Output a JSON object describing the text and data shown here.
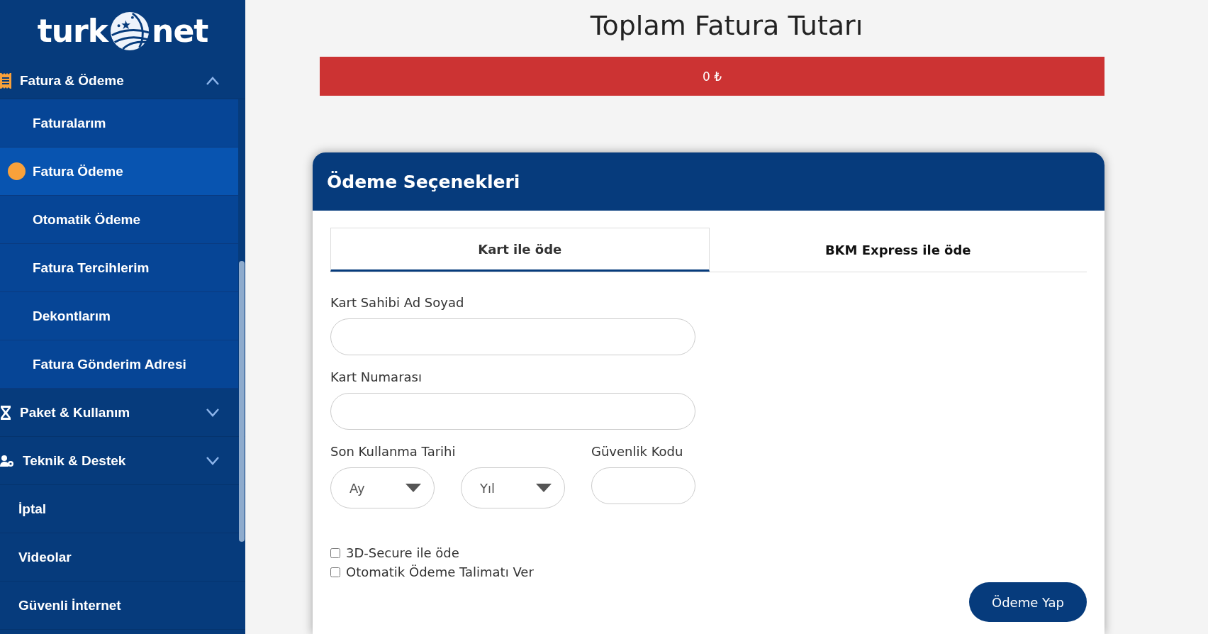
{
  "sidebar": {
    "logo": {
      "left": "turk",
      "right": "net"
    },
    "items": [
      {
        "kind": "group",
        "label": "Fatura & Ödeme",
        "expanded": true,
        "children": [
          {
            "label": "Faturalarım",
            "selected": false
          },
          {
            "label": "Fatura Ödeme",
            "selected": true
          },
          {
            "label": "Otomatik Ödeme",
            "selected": false
          },
          {
            "label": "Fatura Tercihlerim",
            "selected": false
          },
          {
            "label": "Dekontlarım",
            "selected": false
          },
          {
            "label": "Fatura Gönderim Adresi",
            "selected": false
          }
        ]
      },
      {
        "kind": "group",
        "label": "Paket & Kullanım",
        "expanded": false
      },
      {
        "kind": "group",
        "label": "Teknik & Destek",
        "expanded": false
      },
      {
        "kind": "link",
        "label": "İptal"
      },
      {
        "kind": "link",
        "label": "Videolar"
      },
      {
        "kind": "link",
        "label": "Güvenli İnternet"
      }
    ]
  },
  "main": {
    "title": "Toplam Fatura Tutarı",
    "total": "0 ₺",
    "card": {
      "title": "Ödeme Seçenekleri",
      "tabs": [
        {
          "label": "Kart ile öde",
          "selected": true
        },
        {
          "label": "BKM Express ile öde",
          "selected": false
        }
      ],
      "fields": [
        {
          "label": "Kart Sahibi Ad Soyad"
        },
        {
          "label": "Kart Numarası"
        }
      ],
      "expiry": {
        "label": "Son Kullanma Tarihi",
        "month": "Ay",
        "year": "Yıl"
      },
      "cvv": {
        "label": "Güvenlik Kodu"
      },
      "checkboxes": [
        {
          "label": "3D-Secure ile öde",
          "checked": false
        },
        {
          "label": "Otomatik Ödeme Talimatı Ver",
          "checked": false
        }
      ],
      "submit": "Ödeme Yap"
    }
  }
}
